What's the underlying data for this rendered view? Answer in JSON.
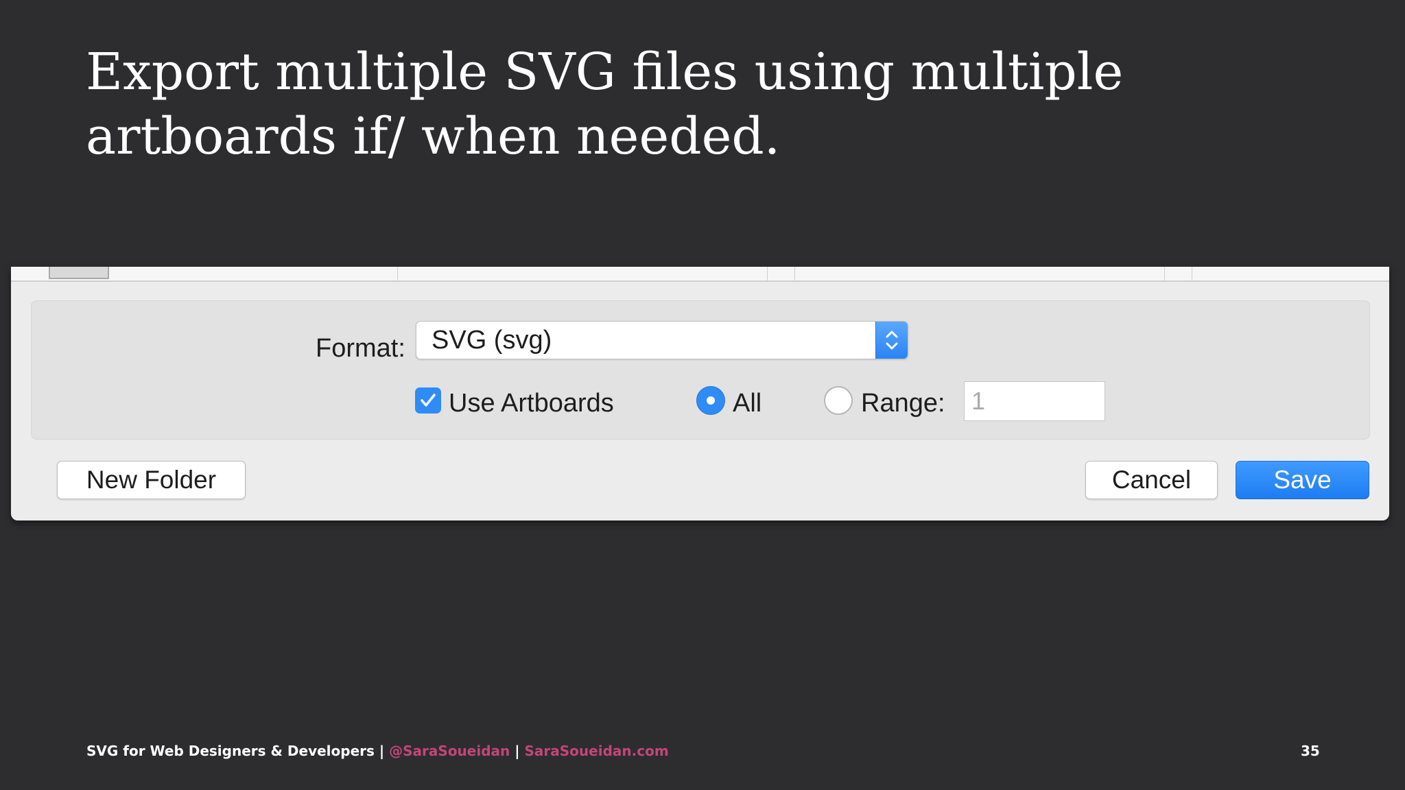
{
  "slide": {
    "title": "Export multiple SVG files using multiple artboards if/ when needed."
  },
  "dialog": {
    "format_label": "Format:",
    "format_value": "SVG (svg)",
    "use_artboards_label": "Use Artboards",
    "use_artboards_checked": true,
    "all_label": "All",
    "all_selected": true,
    "range_label": "Range:",
    "range_placeholder": "1",
    "new_folder_label": "New Folder",
    "cancel_label": "Cancel",
    "save_label": "Save"
  },
  "footer": {
    "prefix": "SVG for Web Designers & Developers | ",
    "handle": "@SaraSoueidan",
    "separator": " | ",
    "site": "SaraSoueidan.com",
    "page_number": "35"
  },
  "colors": {
    "background": "#2d2d2f",
    "accent_blue": "#2f8cf6",
    "footer_link": "#c4457a"
  },
  "icons": [
    "chevron-up-down-icon",
    "checkmark-icon"
  ]
}
